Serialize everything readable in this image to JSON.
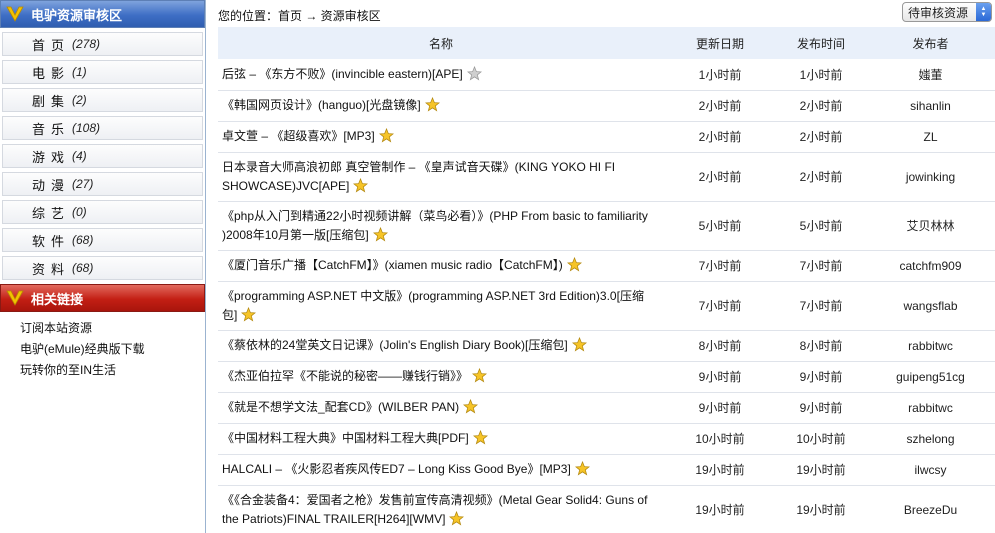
{
  "sidebar": {
    "review_title": "电驴资源审核区",
    "categories": [
      {
        "name": "首页",
        "count": "(278)"
      },
      {
        "name": "电影",
        "count": "(1)"
      },
      {
        "name": "剧集",
        "count": "(2)"
      },
      {
        "name": "音乐",
        "count": "(108)"
      },
      {
        "name": "游戏",
        "count": "(4)"
      },
      {
        "name": "动漫",
        "count": "(27)"
      },
      {
        "name": "综艺",
        "count": "(0)"
      },
      {
        "name": "软件",
        "count": "(68)"
      },
      {
        "name": "资料",
        "count": "(68)"
      }
    ],
    "links_title": "相关链接",
    "links": [
      "订阅本站资源",
      "电驴(eMule)经典版下载",
      "玩转你的至IN生活"
    ]
  },
  "breadcrumb": "您的位置：首页 → 资源审核区",
  "filter": {
    "selected": "待审核资源"
  },
  "table": {
    "headers": {
      "name": "名称",
      "updated": "更新日期",
      "published": "发布时间",
      "publisher": "发布者"
    },
    "rows": [
      {
        "name": "后弦 – 《东方不败》(invincible eastern)[APE]",
        "updated": "1小时前",
        "published": "1小时前",
        "publisher": "媸董",
        "star": "gray"
      },
      {
        "name": "《韩国网页设计》(hanguo)[光盘镜像]",
        "updated": "2小时前",
        "published": "2小时前",
        "publisher": "sihanlin",
        "star": "gold"
      },
      {
        "name": "卓文萱 – 《超级喜欢》[MP3]",
        "updated": "2小时前",
        "published": "2小时前",
        "publisher": "ZL",
        "star": "gold"
      },
      {
        "name": "日本录音大师高浪初郎 真空管制作 – 《皇声试音天碟》(KING YOKO HI FI SHOWCASE)JVC[APE]",
        "updated": "2小时前",
        "published": "2小时前",
        "publisher": "jowinking",
        "star": "gold"
      },
      {
        "name": "《php从入门到精通22小时视频讲解（菜鸟必看）》(PHP From basic to familiarity )2008年10月第一版[压缩包]",
        "updated": "5小时前",
        "published": "5小时前",
        "publisher": "艾贝林林",
        "star": "gold"
      },
      {
        "name": "《厦门音乐广播【CatchFM】》(xiamen music radio【CatchFM】)",
        "updated": "7小时前",
        "published": "7小时前",
        "publisher": "catchfm909",
        "star": "gold"
      },
      {
        "name": "《programming ASP.NET 中文版》(programming ASP.NET 3rd Edition)3.0[压缩包]",
        "updated": "7小时前",
        "published": "7小时前",
        "publisher": "wangsflab",
        "star": "gold"
      },
      {
        "name": "《蔡依林的24堂英文日记课》(Jolin's English Diary Book)[压缩包]",
        "updated": "8小时前",
        "published": "8小时前",
        "publisher": "rabbitwc",
        "star": "gold"
      },
      {
        "name": "《杰亚伯拉罕《不能说的秘密——赚钱行销》》",
        "updated": "9小时前",
        "published": "9小时前",
        "publisher": "guipeng51cg",
        "star": "gold"
      },
      {
        "name": "《就是不想学文法_配套CD》(WILBER PAN)",
        "updated": "9小时前",
        "published": "9小时前",
        "publisher": "rabbitwc",
        "star": "gold"
      },
      {
        "name": "《中国材料工程大典》中国材料工程大典[PDF]",
        "updated": "10小时前",
        "published": "10小时前",
        "publisher": "szhelong",
        "star": "gold"
      },
      {
        "name": "HALCALI – 《火影忍者疾风传ED7 – Long Kiss Good Bye》[MP3]",
        "updated": "19小时前",
        "published": "19小时前",
        "publisher": "ilwcsy",
        "star": "gold"
      },
      {
        "name": "《《合金装备4：爱国者之枪》发售前宣传高清视频》(Metal Gear Solid4: Guns of the Patriots)FINAL TRAILER[H264][WMV]",
        "updated": "19小时前",
        "published": "19小时前",
        "publisher": "BreezeDu",
        "star": "gold"
      }
    ]
  }
}
